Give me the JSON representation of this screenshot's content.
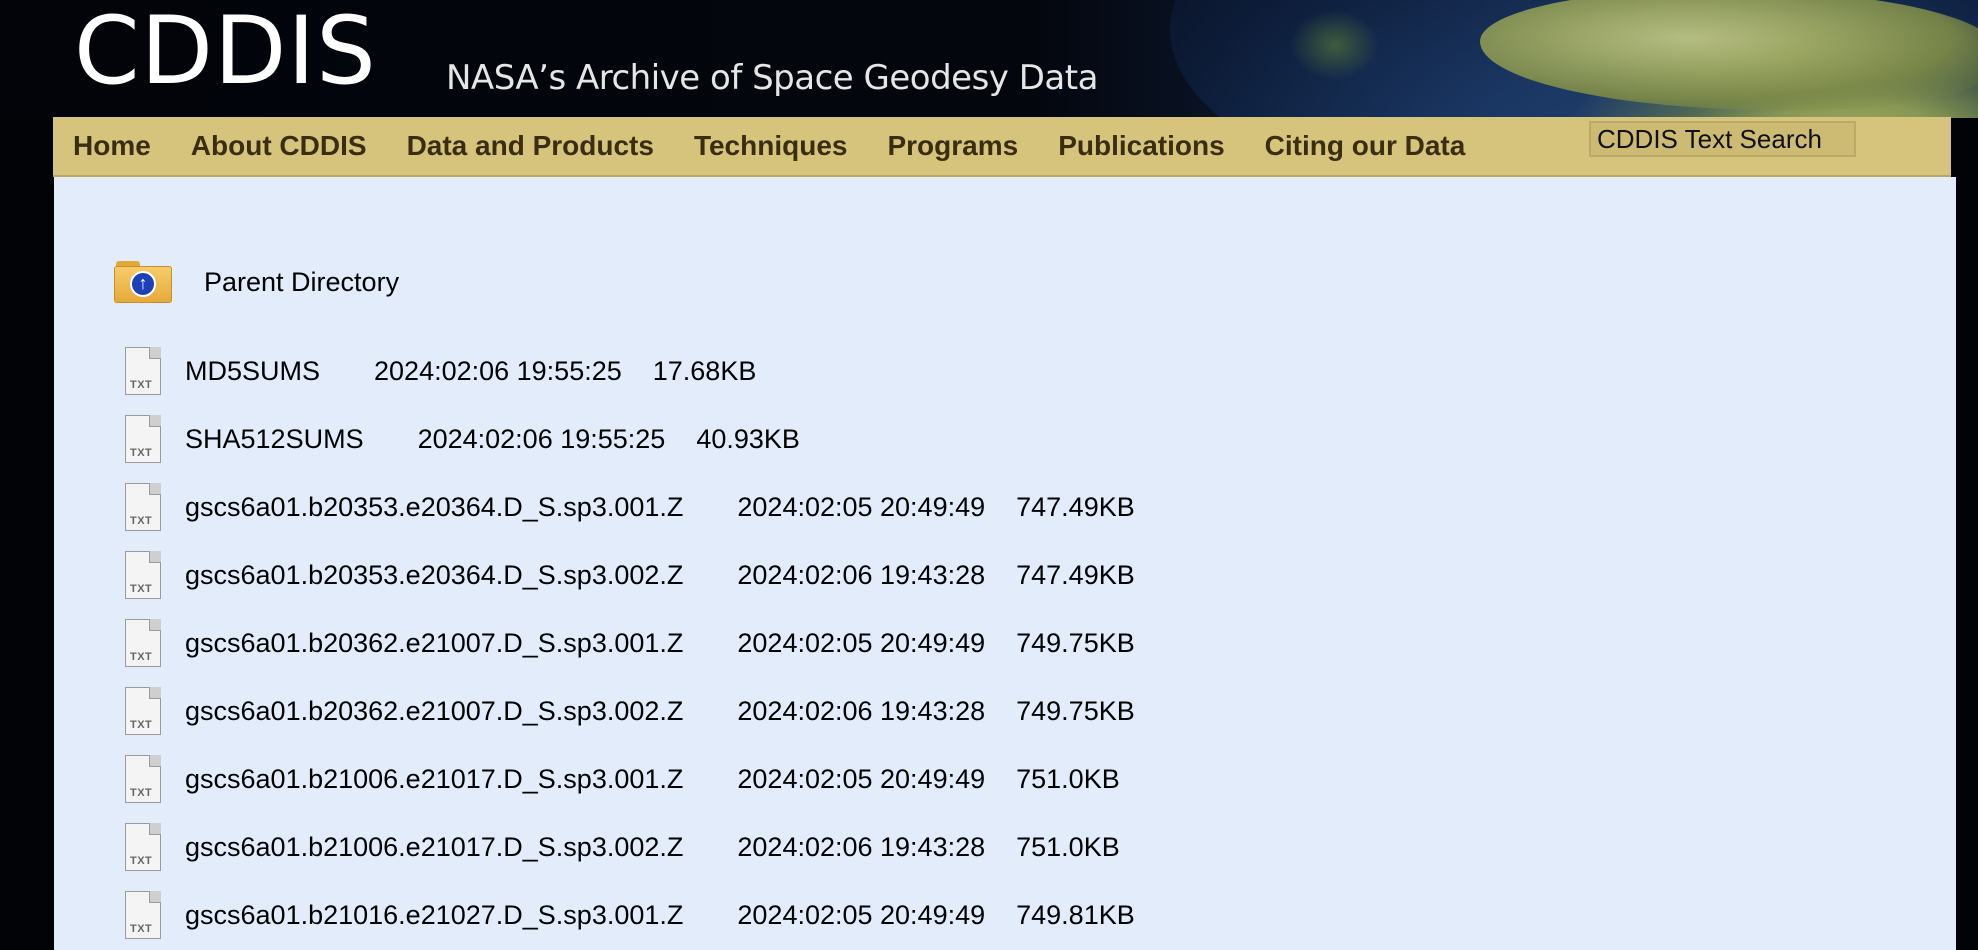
{
  "header": {
    "logo": "CDDIS",
    "tagline": "NASA’s Archive of Space Geodesy Data"
  },
  "nav": {
    "items": [
      "Home",
      "About CDDIS",
      "Data and Products",
      "Techniques",
      "Programs",
      "Publications",
      "Citing our Data"
    ],
    "search_label": "CDDIS Text Search"
  },
  "listing": {
    "parent_label": "Parent Directory",
    "icon_text": "TXT",
    "files": [
      {
        "name": "MD5SUMS",
        "date": "2024:02:06 19:55:25",
        "size": "17.68KB"
      },
      {
        "name": "SHA512SUMS",
        "date": "2024:02:06 19:55:25",
        "size": "40.93KB"
      },
      {
        "name": "gscs6a01.b20353.e20364.D_S.sp3.001.Z",
        "date": "2024:02:05 20:49:49",
        "size": "747.49KB"
      },
      {
        "name": "gscs6a01.b20353.e20364.D_S.sp3.002.Z",
        "date": "2024:02:06 19:43:28",
        "size": "747.49KB"
      },
      {
        "name": "gscs6a01.b20362.e21007.D_S.sp3.001.Z",
        "date": "2024:02:05 20:49:49",
        "size": "749.75KB"
      },
      {
        "name": "gscs6a01.b20362.e21007.D_S.sp3.002.Z",
        "date": "2024:02:06 19:43:28",
        "size": "749.75KB"
      },
      {
        "name": "gscs6a01.b21006.e21017.D_S.sp3.001.Z",
        "date": "2024:02:05 20:49:49",
        "size": "751.0KB"
      },
      {
        "name": "gscs6a01.b21006.e21017.D_S.sp3.002.Z",
        "date": "2024:02:06 19:43:28",
        "size": "751.0KB"
      },
      {
        "name": "gscs6a01.b21016.e21027.D_S.sp3.001.Z",
        "date": "2024:02:05 20:49:49",
        "size": "749.81KB"
      }
    ]
  }
}
